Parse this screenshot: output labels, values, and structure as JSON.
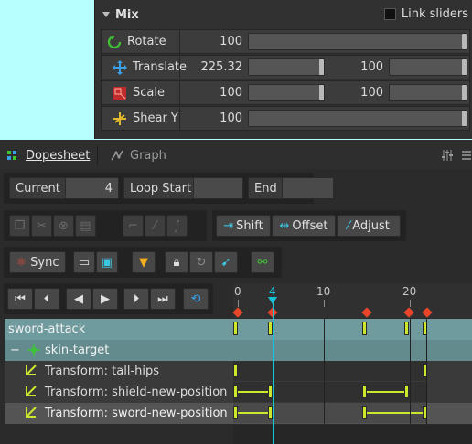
{
  "mix": {
    "title": "Mix",
    "link_label": "Link sliders",
    "rows": [
      {
        "label": "Rotate",
        "icon": "rotate-icon",
        "value": "100",
        "slider": 1.0
      },
      {
        "label": "Translate",
        "icon": "translate-icon",
        "value": "225.32",
        "slider": 1.0,
        "value2": "100",
        "slider2": 1.0
      },
      {
        "label": "Scale",
        "icon": "scale-icon",
        "value": "100",
        "slider": 1.0,
        "value2": "100",
        "slider2": 1.0
      },
      {
        "label": "Shear Y",
        "icon": "shear-icon",
        "value": "100",
        "slider": 1.0
      }
    ]
  },
  "dopesheet": {
    "tabs": [
      {
        "label": "Dopesheet",
        "icon": "dopesheet-icon",
        "active": true
      },
      {
        "label": "Graph",
        "icon": "graph-icon",
        "active": false
      }
    ],
    "frames": {
      "current_label": "Current",
      "current_value": "4",
      "loop_start_label": "Loop Start",
      "loop_start_value": "",
      "end_label": "End",
      "end_value": ""
    },
    "edit_buttons": {
      "shift": "Shift",
      "offset": "Offset",
      "adjust": "Adjust"
    },
    "sync_label": "Sync",
    "ruler_labels": [
      "0",
      "4",
      "10",
      "20"
    ],
    "current_frame": "4",
    "tracks": [
      {
        "name": "sword-attack",
        "type": "animation"
      },
      {
        "name": "skin-target",
        "type": "skin",
        "expander": "−"
      },
      {
        "name": "Transform: tall-hips",
        "type": "transform"
      },
      {
        "name": "Transform: shield-new-position",
        "type": "transform"
      },
      {
        "name": "Transform: sword-new-position",
        "type": "transform"
      }
    ]
  },
  "colors": {
    "key": "#cde82c",
    "playhead": "#18c2d6",
    "marker": "#e8452b",
    "selected_row": "#6f9b9e"
  }
}
